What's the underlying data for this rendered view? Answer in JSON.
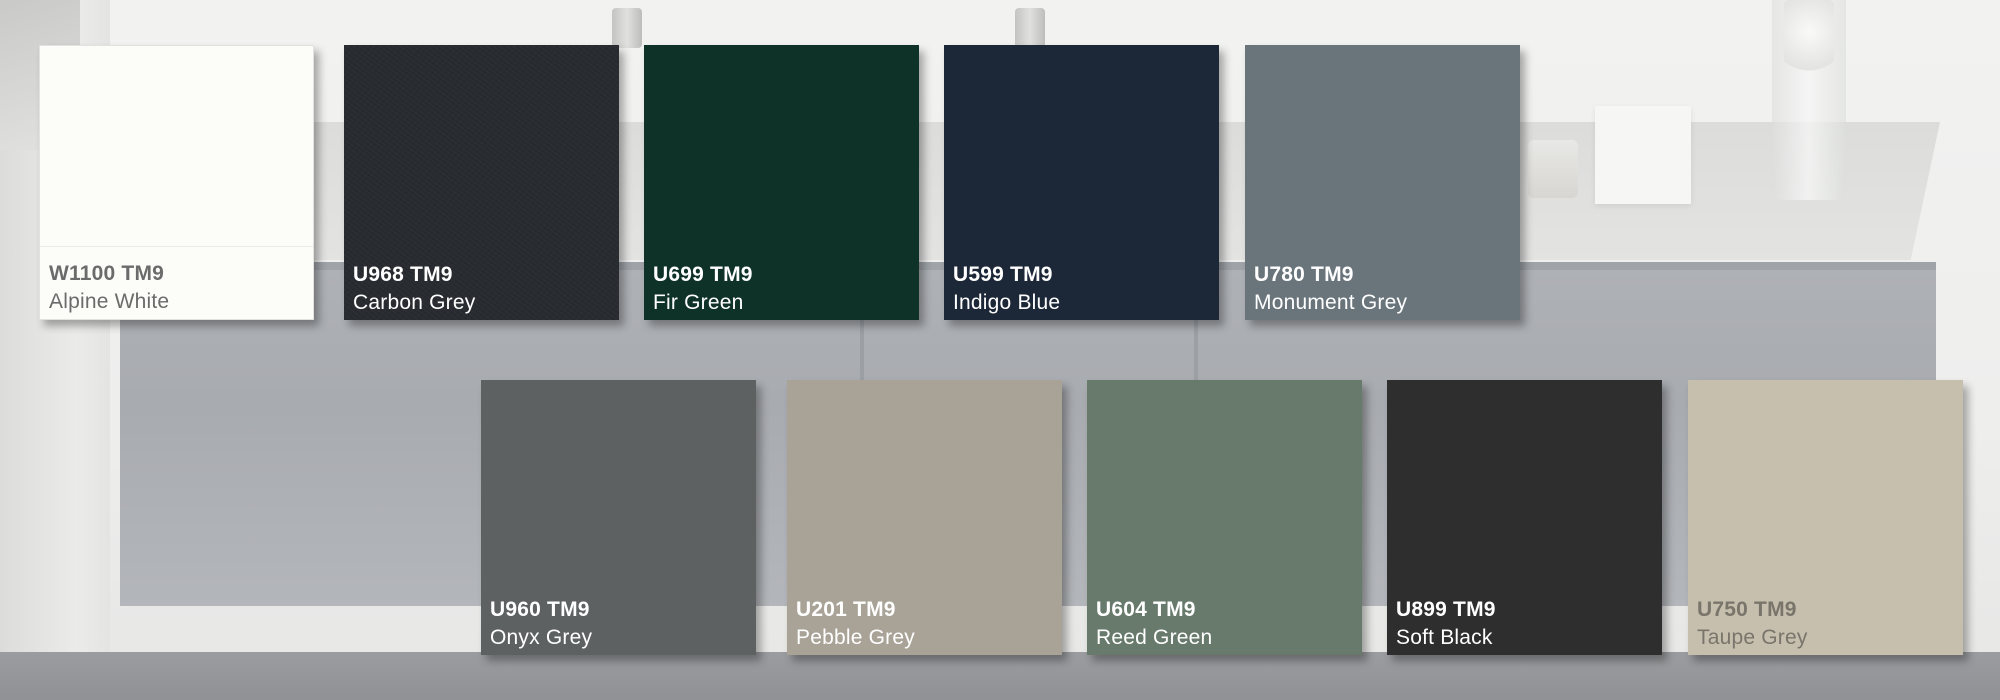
{
  "swatches": [
    {
      "code": "W1100 TM9",
      "name": "Alpine White",
      "color": "#fcfcf8",
      "text_color": "#6b6b6b"
    },
    {
      "code": "U968 TM9",
      "name": "Carbon Grey",
      "color": "#282b30",
      "text_color": "#ffffff"
    },
    {
      "code": "U699 TM9",
      "name": "Fir Green",
      "color": "#0f3228",
      "text_color": "#ffffff"
    },
    {
      "code": "U599 TM9",
      "name": "Indigo Blue",
      "color": "#1c2838",
      "text_color": "#ffffff"
    },
    {
      "code": "U780 TM9",
      "name": "Monument Grey",
      "color": "#69747b",
      "text_color": "#ffffff"
    },
    {
      "code": "U960 TM9",
      "name": "Onyx Grey",
      "color": "#5d6162",
      "text_color": "#ffffff"
    },
    {
      "code": "U201 TM9",
      "name": "Pebble Grey",
      "color": "#a8a297",
      "text_color": "#ffffff"
    },
    {
      "code": "U604 TM9",
      "name": "Reed Green",
      "color": "#687a6c",
      "text_color": "#ffffff"
    },
    {
      "code": "U899 TM9",
      "name": "Soft Black",
      "color": "#2e2e2f",
      "text_color": "#ffffff"
    },
    {
      "code": "U750 TM9",
      "name": "Taupe Grey",
      "color": "#c6bfae",
      "text_color": "#7a756b"
    }
  ]
}
